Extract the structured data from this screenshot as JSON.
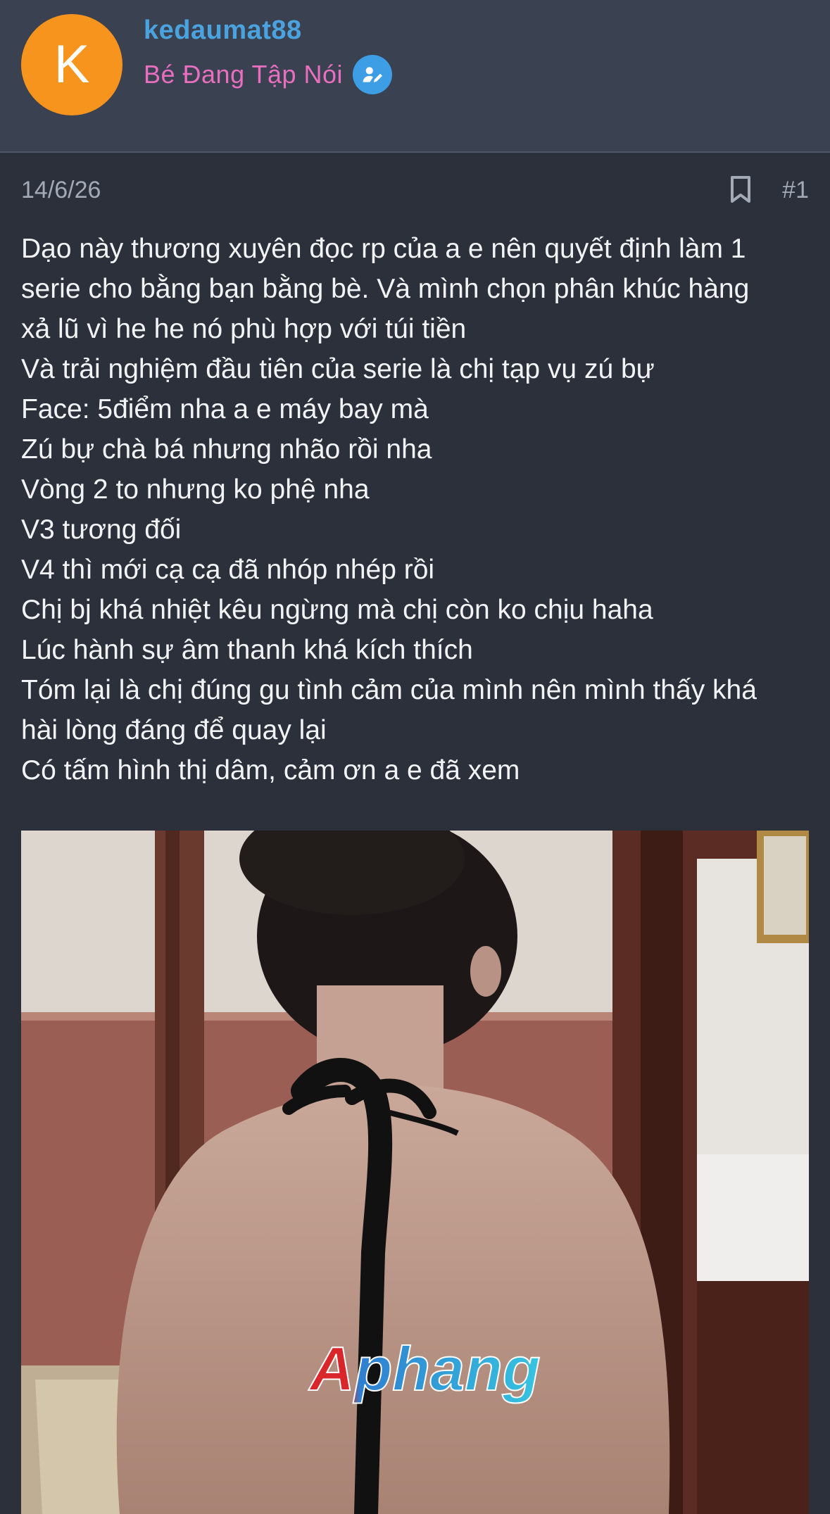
{
  "user": {
    "avatar_letter": "K",
    "avatar_color": "#f7941d",
    "username": "kedaumat88",
    "title": "Bé Đang Tập Nói",
    "badge_icon": "user-edit-icon"
  },
  "post": {
    "date": "14/6/26",
    "number": "#1",
    "bookmark_icon": "bookmark-icon",
    "lines": [
      "Dạo này thương xuyên đọc rp của a e nên quyết định làm 1",
      "serie cho bằng bạn bằng bè. Và mình chọn phân khúc hàng",
      "xả lũ vì he he nó phù hợp với túi tiền",
      "Và trải nghiệm đầu tiên của serie là chị tạp vụ zú bự",
      "Face: 5điểm nha a e máy bay mà",
      "Zú bự chà bá nhưng nhão rồi nha",
      "Vòng 2 to nhưng ko phệ nha",
      "V3 tương đối",
      "V4 thì mới cạ cạ đã nhóp nhép rồi",
      "Chị bj khá nhiệt kêu ngừng mà chị còn ko chịu haha",
      "Lúc hành sự âm thanh khá kích thích",
      "Tóm lại là chị đúng gu tình cảm của mình nên mình thấy khá",
      "hài lòng đáng để quay lại",
      "Có tấm hình thị dâm, cảm ơn a e đã xem"
    ],
    "image": {
      "watermark": "Aphang"
    }
  },
  "colors": {
    "background": "#2c303b",
    "header": "#3a4150",
    "username": "#4aa3df",
    "user_title": "#e86fbf",
    "badge": "#3d9ee6",
    "meta_text": "#a3aab6",
    "body_text": "#f2f3f5"
  }
}
